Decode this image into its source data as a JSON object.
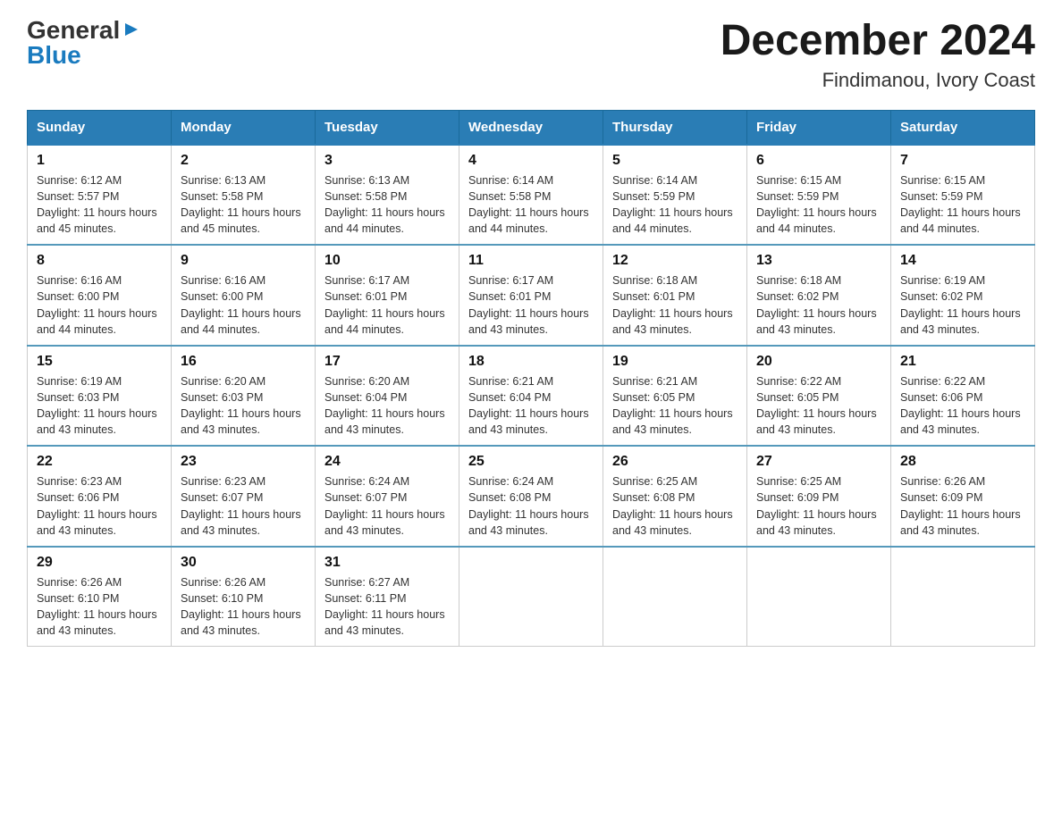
{
  "logo": {
    "general": "General",
    "blue": "Blue",
    "arrow": "▶"
  },
  "title": "December 2024",
  "location": "Findimanou, Ivory Coast",
  "days_of_week": [
    "Sunday",
    "Monday",
    "Tuesday",
    "Wednesday",
    "Thursday",
    "Friday",
    "Saturday"
  ],
  "weeks": [
    [
      {
        "day": "1",
        "sunrise": "6:12 AM",
        "sunset": "5:57 PM",
        "daylight": "11 hours and 45 minutes."
      },
      {
        "day": "2",
        "sunrise": "6:13 AM",
        "sunset": "5:58 PM",
        "daylight": "11 hours and 45 minutes."
      },
      {
        "day": "3",
        "sunrise": "6:13 AM",
        "sunset": "5:58 PM",
        "daylight": "11 hours and 44 minutes."
      },
      {
        "day": "4",
        "sunrise": "6:14 AM",
        "sunset": "5:58 PM",
        "daylight": "11 hours and 44 minutes."
      },
      {
        "day": "5",
        "sunrise": "6:14 AM",
        "sunset": "5:59 PM",
        "daylight": "11 hours and 44 minutes."
      },
      {
        "day": "6",
        "sunrise": "6:15 AM",
        "sunset": "5:59 PM",
        "daylight": "11 hours and 44 minutes."
      },
      {
        "day": "7",
        "sunrise": "6:15 AM",
        "sunset": "5:59 PM",
        "daylight": "11 hours and 44 minutes."
      }
    ],
    [
      {
        "day": "8",
        "sunrise": "6:16 AM",
        "sunset": "6:00 PM",
        "daylight": "11 hours and 44 minutes."
      },
      {
        "day": "9",
        "sunrise": "6:16 AM",
        "sunset": "6:00 PM",
        "daylight": "11 hours and 44 minutes."
      },
      {
        "day": "10",
        "sunrise": "6:17 AM",
        "sunset": "6:01 PM",
        "daylight": "11 hours and 44 minutes."
      },
      {
        "day": "11",
        "sunrise": "6:17 AM",
        "sunset": "6:01 PM",
        "daylight": "11 hours and 43 minutes."
      },
      {
        "day": "12",
        "sunrise": "6:18 AM",
        "sunset": "6:01 PM",
        "daylight": "11 hours and 43 minutes."
      },
      {
        "day": "13",
        "sunrise": "6:18 AM",
        "sunset": "6:02 PM",
        "daylight": "11 hours and 43 minutes."
      },
      {
        "day": "14",
        "sunrise": "6:19 AM",
        "sunset": "6:02 PM",
        "daylight": "11 hours and 43 minutes."
      }
    ],
    [
      {
        "day": "15",
        "sunrise": "6:19 AM",
        "sunset": "6:03 PM",
        "daylight": "11 hours and 43 minutes."
      },
      {
        "day": "16",
        "sunrise": "6:20 AM",
        "sunset": "6:03 PM",
        "daylight": "11 hours and 43 minutes."
      },
      {
        "day": "17",
        "sunrise": "6:20 AM",
        "sunset": "6:04 PM",
        "daylight": "11 hours and 43 minutes."
      },
      {
        "day": "18",
        "sunrise": "6:21 AM",
        "sunset": "6:04 PM",
        "daylight": "11 hours and 43 minutes."
      },
      {
        "day": "19",
        "sunrise": "6:21 AM",
        "sunset": "6:05 PM",
        "daylight": "11 hours and 43 minutes."
      },
      {
        "day": "20",
        "sunrise": "6:22 AM",
        "sunset": "6:05 PM",
        "daylight": "11 hours and 43 minutes."
      },
      {
        "day": "21",
        "sunrise": "6:22 AM",
        "sunset": "6:06 PM",
        "daylight": "11 hours and 43 minutes."
      }
    ],
    [
      {
        "day": "22",
        "sunrise": "6:23 AM",
        "sunset": "6:06 PM",
        "daylight": "11 hours and 43 minutes."
      },
      {
        "day": "23",
        "sunrise": "6:23 AM",
        "sunset": "6:07 PM",
        "daylight": "11 hours and 43 minutes."
      },
      {
        "day": "24",
        "sunrise": "6:24 AM",
        "sunset": "6:07 PM",
        "daylight": "11 hours and 43 minutes."
      },
      {
        "day": "25",
        "sunrise": "6:24 AM",
        "sunset": "6:08 PM",
        "daylight": "11 hours and 43 minutes."
      },
      {
        "day": "26",
        "sunrise": "6:25 AM",
        "sunset": "6:08 PM",
        "daylight": "11 hours and 43 minutes."
      },
      {
        "day": "27",
        "sunrise": "6:25 AM",
        "sunset": "6:09 PM",
        "daylight": "11 hours and 43 minutes."
      },
      {
        "day": "28",
        "sunrise": "6:26 AM",
        "sunset": "6:09 PM",
        "daylight": "11 hours and 43 minutes."
      }
    ],
    [
      {
        "day": "29",
        "sunrise": "6:26 AM",
        "sunset": "6:10 PM",
        "daylight": "11 hours and 43 minutes."
      },
      {
        "day": "30",
        "sunrise": "6:26 AM",
        "sunset": "6:10 PM",
        "daylight": "11 hours and 43 minutes."
      },
      {
        "day": "31",
        "sunrise": "6:27 AM",
        "sunset": "6:11 PM",
        "daylight": "11 hours and 43 minutes."
      },
      null,
      null,
      null,
      null
    ]
  ],
  "labels": {
    "sunrise": "Sunrise:",
    "sunset": "Sunset:",
    "daylight": "Daylight:"
  }
}
